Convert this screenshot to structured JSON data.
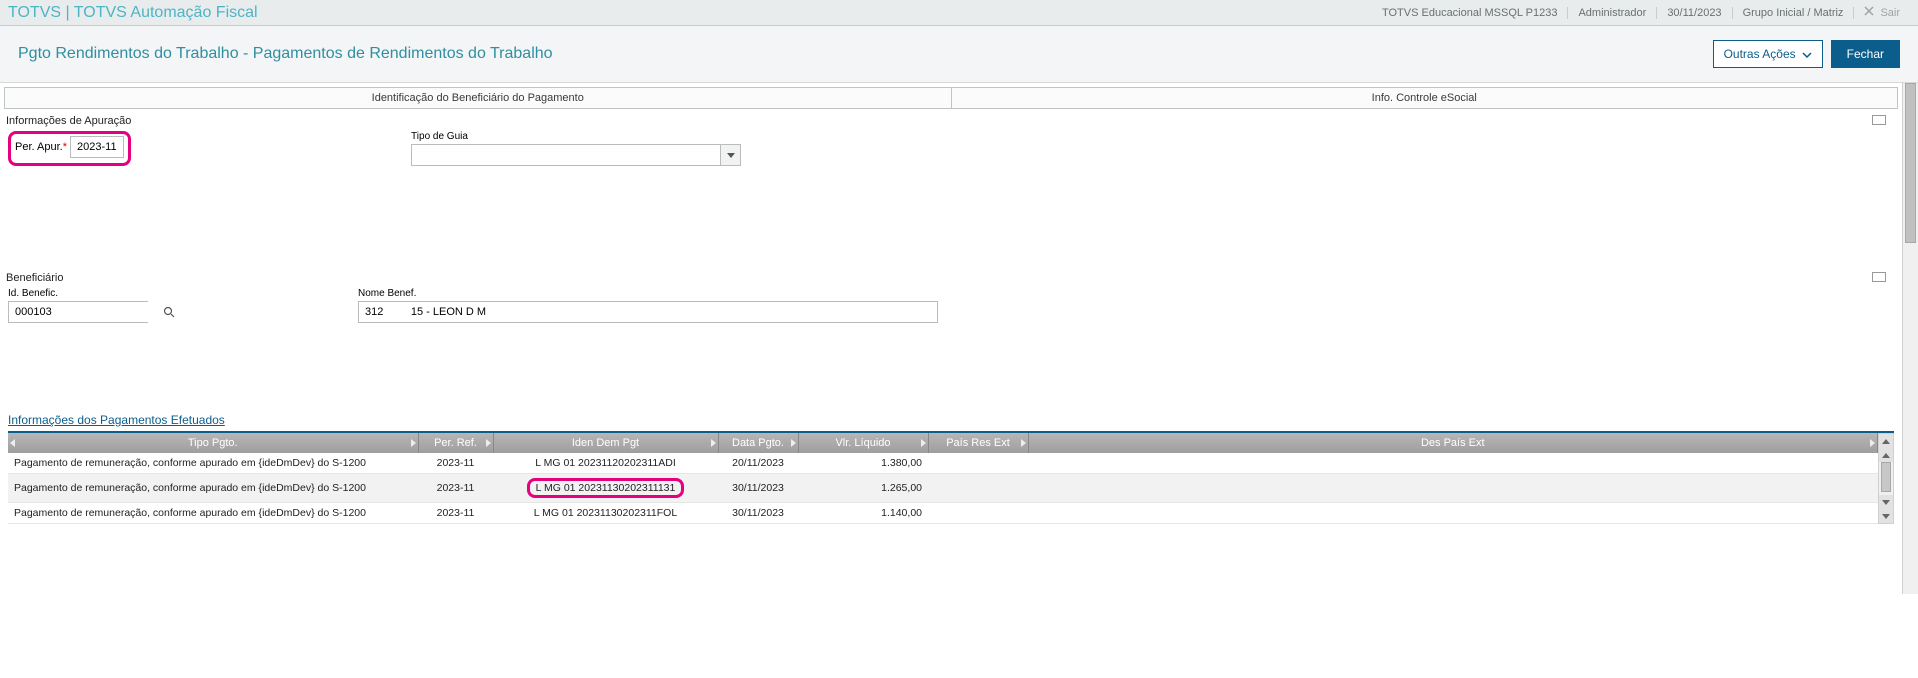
{
  "topbar": {
    "title": "TOTVS | TOTVS Automação Fiscal",
    "env": "TOTVS Educacional MSSQL P1233",
    "user": "Administrador",
    "date": "30/11/2023",
    "group": "Grupo Inicial / Matriz",
    "exit_label": "Sair"
  },
  "subheader": {
    "title": "Pgto Rendimentos do Trabalho - Pagamentos de Rendimentos do Trabalho",
    "outras_label": "Outras Ações",
    "fechar_label": "Fechar"
  },
  "tabs": {
    "tab1": "Identificação do Beneficiário do Pagamento",
    "tab2": "Info. Controle eSocial"
  },
  "section_apuracao": {
    "label": "Informações de Apuração",
    "per_apur_label": "Per. Apur.",
    "per_apur_value": "2023-11",
    "tipo_guia_label": "Tipo de Guia",
    "tipo_guia_value": ""
  },
  "section_beneficiario": {
    "label": "Beneficiário",
    "id_label": "Id. Benefic.",
    "id_value": "000103",
    "nome_label": "Nome Benef.",
    "nome_value": "312         15 - LEON D M"
  },
  "payments": {
    "title": "Informações dos Pagamentos Efetuados",
    "headers": {
      "tipo": "Tipo Pgto.",
      "per_ref": "Per. Ref.",
      "iden": "Iden Dem Pgt",
      "data": "Data Pgto.",
      "vlr": "Vlr. Líquido",
      "pais": "País Res Ext",
      "des_pais": "Des País Ext"
    },
    "rows": [
      {
        "tipo": "Pagamento de remuneração, conforme apurado em {ideDmDev} do S-1200",
        "per_ref": "2023-11",
        "iden": "L MG 01 20231120202311ADI",
        "data": "20/11/2023",
        "vlr": "1.380,00",
        "pais": "",
        "des_pais": "",
        "highlight": false
      },
      {
        "tipo": "Pagamento de remuneração, conforme apurado em {ideDmDev} do S-1200",
        "per_ref": "2023-11",
        "iden": "L MG 01 20231130202311131",
        "data": "30/11/2023",
        "vlr": "1.265,00",
        "pais": "",
        "des_pais": "",
        "highlight": true
      },
      {
        "tipo": "Pagamento de remuneração, conforme apurado em {ideDmDev} do S-1200",
        "per_ref": "2023-11",
        "iden": "L MG 01 20231130202311FOL",
        "data": "30/11/2023",
        "vlr": "1.140,00",
        "pais": "",
        "des_pais": "",
        "highlight": false
      }
    ]
  }
}
